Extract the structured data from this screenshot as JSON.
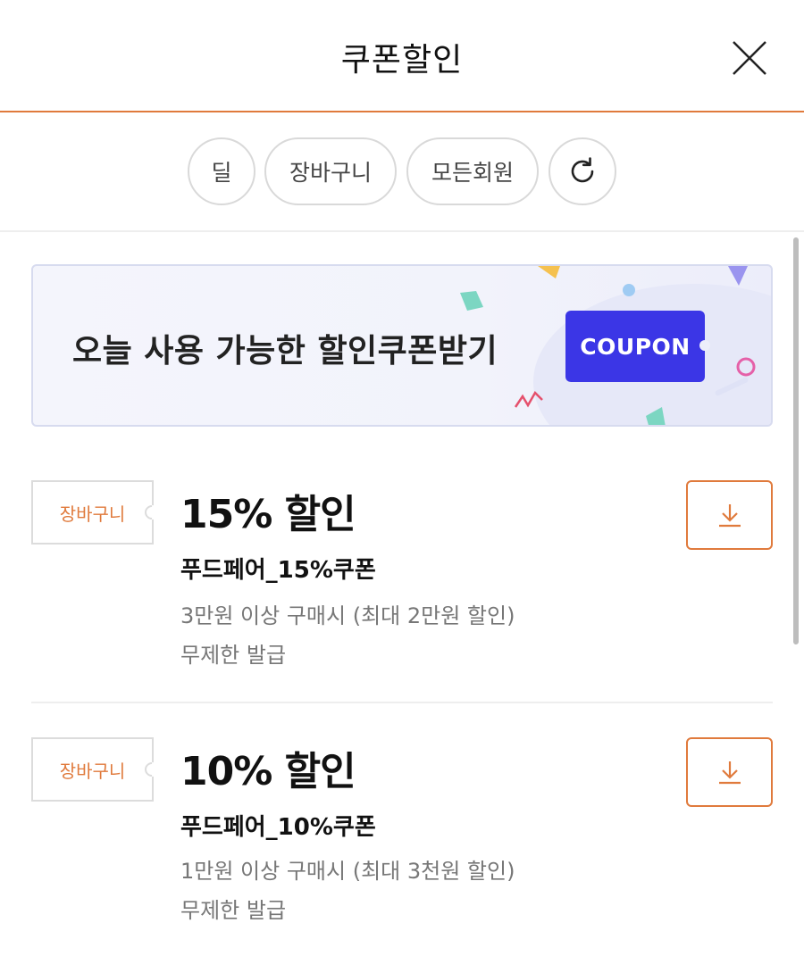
{
  "header": {
    "title": "쿠폰할인",
    "close_icon": "close-icon"
  },
  "filters": {
    "chips": [
      "딜",
      "장바구니",
      "모든회원"
    ],
    "refresh_icon": "refresh-icon"
  },
  "banner": {
    "text": "오늘 사용 가능한 할인쿠폰받기",
    "coupon_label": "COUPON",
    "accent_color": "#3b36e6"
  },
  "coupons": [
    {
      "tag": "장바구니",
      "amount": "15% 할인",
      "name": "푸드페어_15%쿠폰",
      "condition": "3만원 이상 구매시 (최대 2만원 할인)",
      "issue": "무제한 발급",
      "download_icon": "download-icon"
    },
    {
      "tag": "장바구니",
      "amount": "10% 할인",
      "name": "푸드페어_10%쿠폰",
      "condition": "1만원 이상 구매시 (최대 3천원 할인)",
      "issue": "무제한 발급",
      "download_icon": "download-icon"
    }
  ],
  "colors": {
    "accent": "#e07a3c",
    "banner_button": "#3b36e6"
  }
}
